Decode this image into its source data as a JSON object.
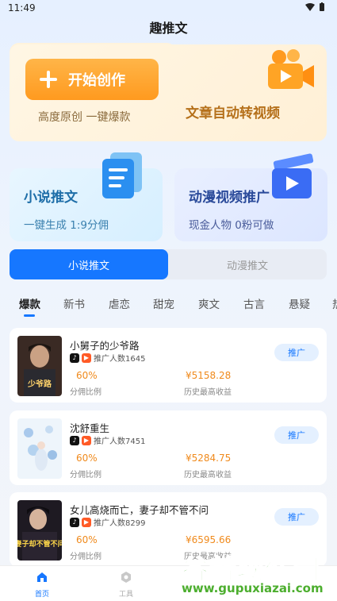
{
  "status_bar": {
    "time": "11:49",
    "icons": "▾ ▮"
  },
  "app": {
    "title": "趣推文"
  },
  "banner": {
    "start_label": "开始创作",
    "subtitle": "高度原创 一键爆款",
    "slogan": "文章自动转视频",
    "icon": "video-camera-icon"
  },
  "features": [
    {
      "title": "小说推文",
      "subtitle": "一键生成 1:9分佣",
      "icon": "document-icon"
    },
    {
      "title": "动漫视频推广",
      "subtitle": "现金人物 0粉可做",
      "icon": "clapper-icon"
    }
  ],
  "segment": {
    "tabs": [
      "小说推文",
      "动漫推文"
    ],
    "active": 0
  },
  "categories": [
    "爆款",
    "新书",
    "虐恋",
    "甜宠",
    "爽文",
    "古言",
    "悬疑",
    "热"
  ],
  "books": [
    {
      "title": "小舅子的少爷路",
      "promoters": "推广人数1645",
      "commission": "60%",
      "commission_label": "分佣比例",
      "earnings": "¥5158.28",
      "earnings_label": "历史最高收益",
      "button": "推广",
      "cover_text": "少爷路"
    },
    {
      "title": "沈舒重生",
      "promoters": "推广人数7451",
      "commission": "60%",
      "commission_label": "分佣比例",
      "earnings": "¥5284.75",
      "earnings_label": "历史最高收益",
      "button": "推广",
      "cover_text": ""
    },
    {
      "title": "女儿高烧而亡，妻子却不管不问",
      "promoters": "推广人数8299",
      "commission": "60%",
      "commission_label": "分佣比例",
      "earnings": "¥6595.66",
      "earnings_label": "历史最高收益",
      "button": "推广",
      "cover_text": "妻子却不管不问"
    }
  ],
  "nav": [
    {
      "label": "首页",
      "icon": "home-icon"
    },
    {
      "label": "工具",
      "icon": "tools-icon"
    }
  ],
  "watermark": {
    "big": "谷普软件园",
    "url": "www.gupuxiazai.com"
  },
  "colors": {
    "accent": "#1677ff",
    "orange": "#f08a1c"
  }
}
